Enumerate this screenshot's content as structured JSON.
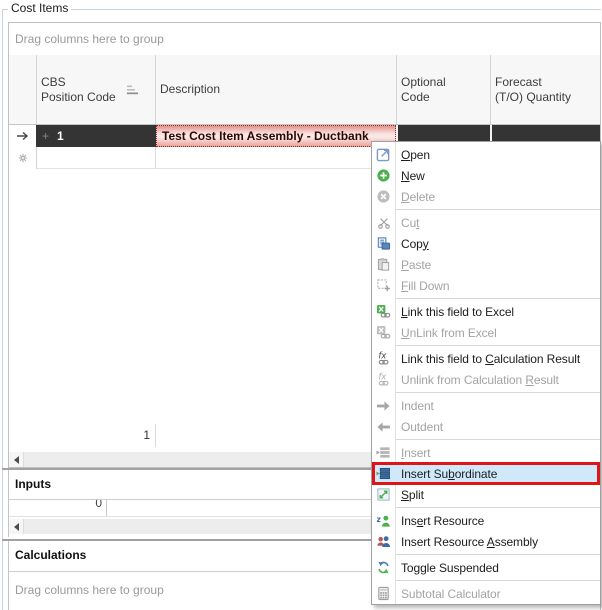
{
  "group_box": {
    "title": "Cost Items"
  },
  "cost_items_grid": {
    "group_hint": "Drag columns here to group",
    "columns": [
      {
        "line1": "CBS",
        "line2": "Position Code",
        "sorted": true
      },
      {
        "line1": "Description",
        "line2": ""
      },
      {
        "line1": "Optional",
        "line2": "Code"
      },
      {
        "line1": "Forecast",
        "line2": "(T/O) Quantity"
      }
    ],
    "rows": [
      {
        "indicator": "current-row-arrow",
        "expand_glyph": "+",
        "cbs_position_code": "1",
        "description": "Test Cost Item Assembly - Ductbank"
      },
      {
        "indicator": "new-row-asterisk",
        "cbs_position_code": "",
        "description": ""
      }
    ],
    "footer_count": "1"
  },
  "inputs_panel": {
    "title": "Inputs",
    "partial_value": "0"
  },
  "calculations_panel": {
    "title": "Calculations",
    "group_hint": "Drag columns here to group"
  },
  "context_menu": {
    "groups": [
      {
        "items": [
          {
            "label": "&Open",
            "icon": "open-icon",
            "enabled": true
          },
          {
            "label": "&New",
            "icon": "new-icon",
            "enabled": true
          },
          {
            "label": "&Delete",
            "icon": "delete-icon",
            "enabled": false
          }
        ]
      },
      {
        "items": [
          {
            "label": "Cu&t",
            "icon": "cut-icon",
            "enabled": false
          },
          {
            "label": "Cop&y",
            "icon": "copy-icon",
            "enabled": true
          },
          {
            "label": "&Paste",
            "icon": "paste-icon",
            "enabled": false
          },
          {
            "label": "&Fill Down",
            "icon": "fill-down-icon",
            "enabled": false
          }
        ]
      },
      {
        "items": [
          {
            "label": "&Link this field to Excel",
            "icon": "excel-link-icon",
            "enabled": true
          },
          {
            "label": "&UnLink from Excel",
            "icon": "excel-unlink-icon",
            "enabled": false
          }
        ]
      },
      {
        "items": [
          {
            "label": "Link this field to &Calculation Result",
            "icon": "calc-link-icon",
            "enabled": true
          },
          {
            "label": "Unlink from Calculation &Result",
            "icon": "calc-unlink-icon",
            "enabled": false
          }
        ]
      },
      {
        "items": [
          {
            "label": "Indent",
            "icon": "indent-icon",
            "enabled": false
          },
          {
            "label": "Outdent",
            "icon": "outdent-icon",
            "enabled": false
          }
        ]
      },
      {
        "items": [
          {
            "label": "&Insert",
            "icon": "insert-icon",
            "enabled": false
          },
          {
            "label": "Insert Su&bordinate",
            "icon": "insert-subordinate-icon",
            "enabled": true,
            "highlighted": true,
            "annotated": true
          },
          {
            "label": "&Split",
            "icon": "split-icon",
            "enabled": true
          }
        ]
      },
      {
        "items": [
          {
            "label": "Ins&ert Resource",
            "icon": "insert-resource-icon",
            "enabled": true
          },
          {
            "label": "Insert Resource &Assembly",
            "icon": "insert-resource-assembly-icon",
            "enabled": true
          }
        ]
      },
      {
        "items": [
          {
            "label": "To&ggle Suspended",
            "icon": "toggle-suspended-icon",
            "enabled": true
          }
        ]
      },
      {
        "items": [
          {
            "label": "Subtotal Calculator",
            "icon": "subtotal-calculator-icon",
            "enabled": false
          }
        ]
      }
    ]
  },
  "colors": {
    "selected_row_bg": "#343434",
    "description_highlight_bg": "#f2b6b1",
    "description_text": "#2a0803",
    "menu_hover_bg": "#cfe9fb",
    "annotation_red": "#df1418",
    "disabled_text": "#a3a3a3",
    "hint_text": "#9a9a9a"
  }
}
